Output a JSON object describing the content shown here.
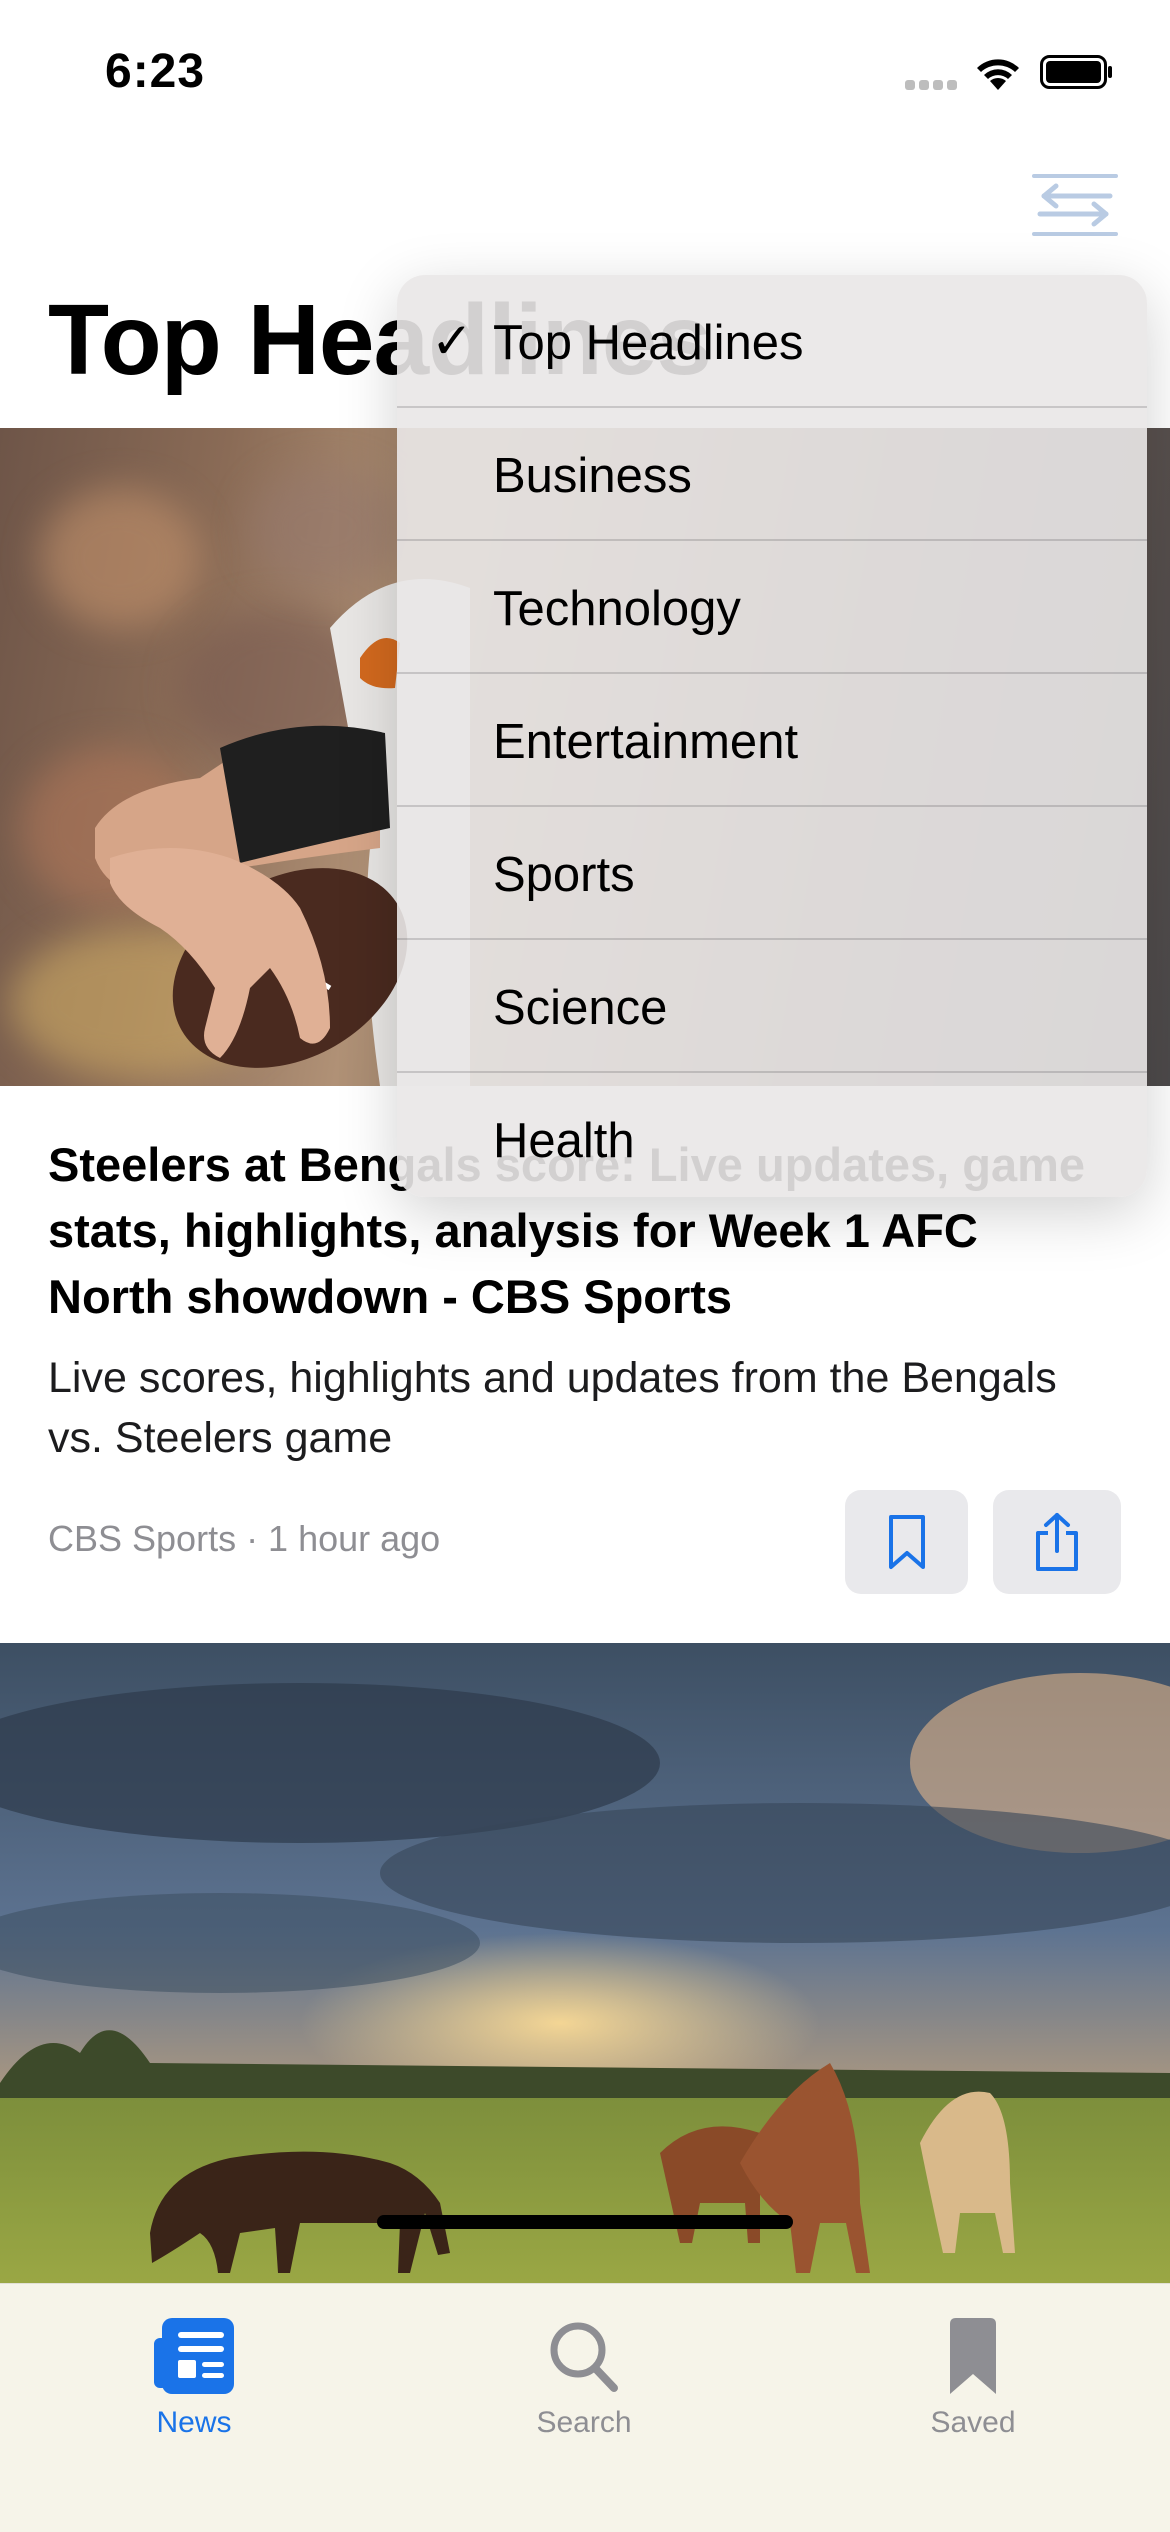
{
  "status_bar": {
    "time": "6:23"
  },
  "header": {
    "title": "Top Headlines",
    "filter_icon": "arrow-swap-icon"
  },
  "dropdown": {
    "selected": "Top Headlines",
    "items": [
      {
        "label": "Top Headlines",
        "checked": true
      },
      {
        "label": "Business",
        "checked": false
      },
      {
        "label": "Technology",
        "checked": false
      },
      {
        "label": "Entertainment",
        "checked": false
      },
      {
        "label": "Sports",
        "checked": false
      },
      {
        "label": "Science",
        "checked": false
      },
      {
        "label": "Health",
        "checked": false
      }
    ]
  },
  "articles": [
    {
      "headline": "Steelers at Bengals score: Live updates, game stats, highlights, analysis for Week 1 AFC North showdown - CBS Sports",
      "summary": "Live scores, highlights and updates from the Bengals vs. Steelers game",
      "meta": "CBS Sports · 1 hour ago",
      "image": "football-player-photo"
    },
    {
      "image": "horses-grazing-photo"
    }
  ],
  "tab_bar": {
    "tabs": [
      {
        "label": "News",
        "icon": "newspaper-icon",
        "active": true
      },
      {
        "label": "Search",
        "icon": "magnifier-icon",
        "active": false
      },
      {
        "label": "Saved",
        "icon": "bookmark-icon",
        "active": false
      }
    ]
  },
  "colors": {
    "accent": "#1a73e8",
    "inactive": "#8e8e93",
    "tab_bar_bg": "#f6f4e8"
  }
}
